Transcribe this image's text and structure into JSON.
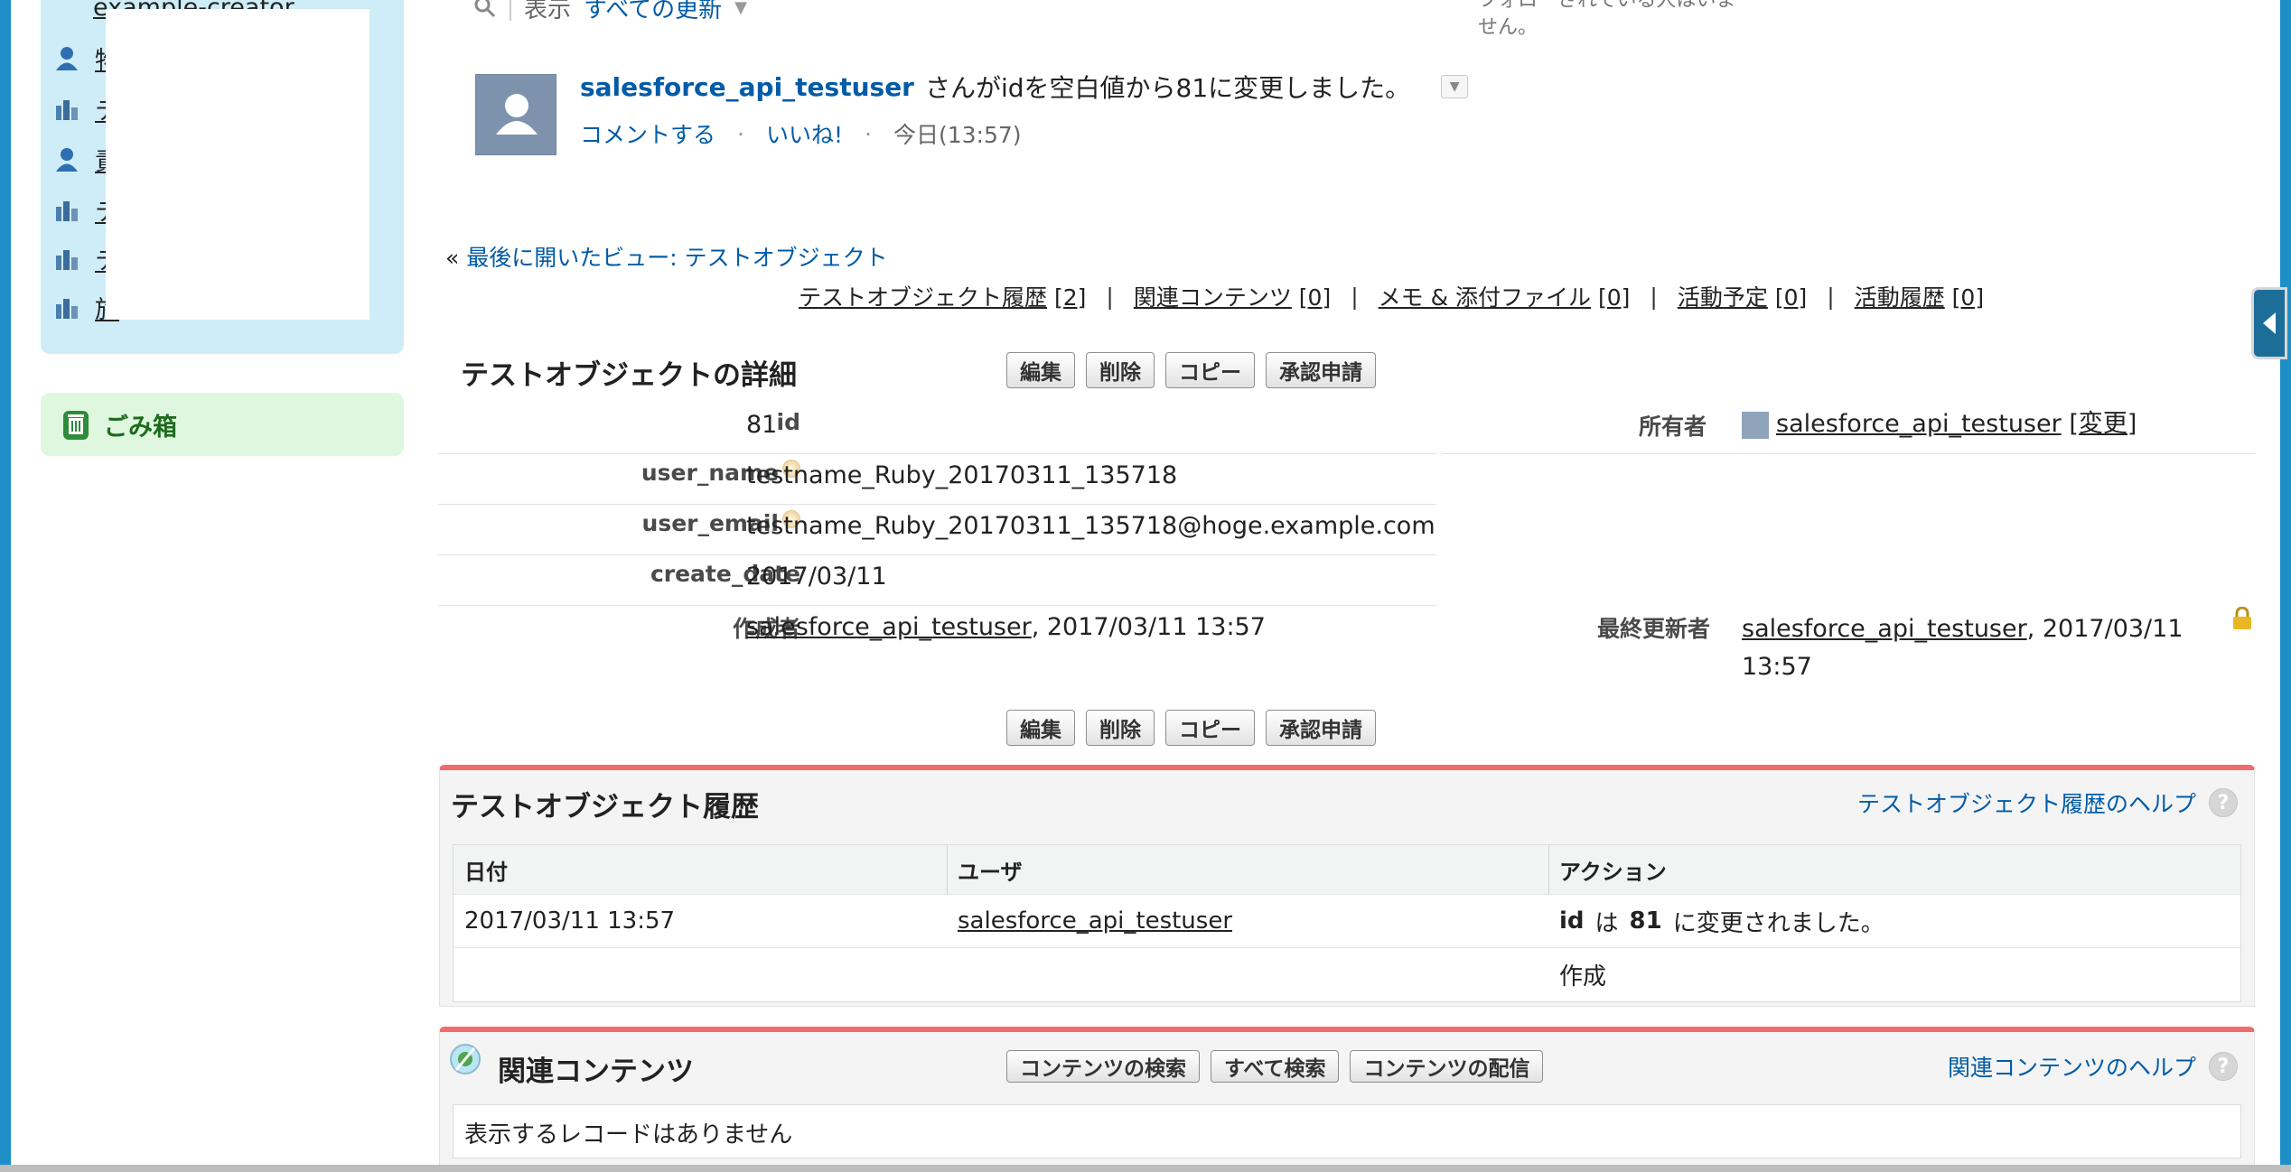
{
  "sidebar": {
    "top_item": "example-creator",
    "items": [
      {
        "icon": "user-icon",
        "label": "物"
      },
      {
        "icon": "building-icon",
        "label": "テ"
      },
      {
        "icon": "user-icon",
        "label": "責"
      },
      {
        "icon": "building-icon",
        "label": "テ"
      },
      {
        "icon": "building-icon",
        "label": "テ"
      },
      {
        "icon": "building-icon",
        "label": "施"
      }
    ],
    "trash_label": "ごみ箱"
  },
  "filter": {
    "prefix": "表示",
    "selected": "すべての更新",
    "follow_note": "フォローされている人はいません。"
  },
  "feed": {
    "user": "salesforce_api_testuser",
    "message": "さんがidを空白値から81に変更しました。",
    "comment": "コメントする",
    "like": "いいね!",
    "time": "今日(13:57)",
    "dot": "·"
  },
  "back_link": {
    "prefix": "«",
    "label": "最後に開いたビュー: テストオブジェクト"
  },
  "related_links": [
    {
      "label": "テストオブジェクト履歴",
      "count": "[2]"
    },
    {
      "label": "関連コンテンツ",
      "count": "[0]"
    },
    {
      "label": "メモ & 添付ファイル",
      "count": "[0]"
    },
    {
      "label": "活動予定",
      "count": "[0]"
    },
    {
      "label": "活動履歴",
      "count": "[0]"
    }
  ],
  "detail": {
    "title": "テストオブジェクトの詳細",
    "buttons": {
      "edit": "編集",
      "delete": "削除",
      "copy": "コピー",
      "approve": "承認申請"
    },
    "fields": {
      "id_label": "id",
      "id_value": "81",
      "user_name_label": "user_name",
      "user_name_value": "testname_Ruby_20170311_135718",
      "user_email_label": "user_email",
      "user_email_value": "testname_Ruby_20170311_135718@hoge.example.com",
      "create_date_label": "create_date",
      "create_date_value": "2017/03/11",
      "created_by_label": "作成者",
      "created_by_user": "salesforce_api_testuser",
      "created_by_date": ", 2017/03/11 13:57",
      "owner_label": "所有者",
      "owner_user": "salesforce_api_testuser",
      "owner_change": "[変更]",
      "modified_by_label": "最終更新者",
      "modified_by_user": "salesforce_api_testuser",
      "modified_by_date1": ", 2017/03/11",
      "modified_by_date2": "13:57"
    }
  },
  "history": {
    "title": "テストオブジェクト履歴",
    "help": "テストオブジェクト履歴のヘルプ",
    "columns": [
      "日付",
      "ユーザ",
      "アクション"
    ],
    "rows": [
      {
        "date": "2017/03/11 13:57",
        "user": "salesforce_api_testuser",
        "field": "id",
        "mid": "は",
        "value": "81",
        "tail": "に変更されました。"
      },
      {
        "date": "",
        "user": "",
        "action": "作成"
      }
    ]
  },
  "content": {
    "title": "関連コンテンツ",
    "buttons": {
      "search": "コンテンツの検索",
      "search_all": "すべて検索",
      "deliver": "コンテンツの配信"
    },
    "help": "関連コンテンツのヘルプ",
    "empty": "表示するレコードはありません"
  },
  "colors": {
    "accent": "#015ba7",
    "panel_border": "#f06c6c",
    "sidebar": "#cfedf8",
    "trash": "#dff7df",
    "frame": "#1f8fc7"
  }
}
